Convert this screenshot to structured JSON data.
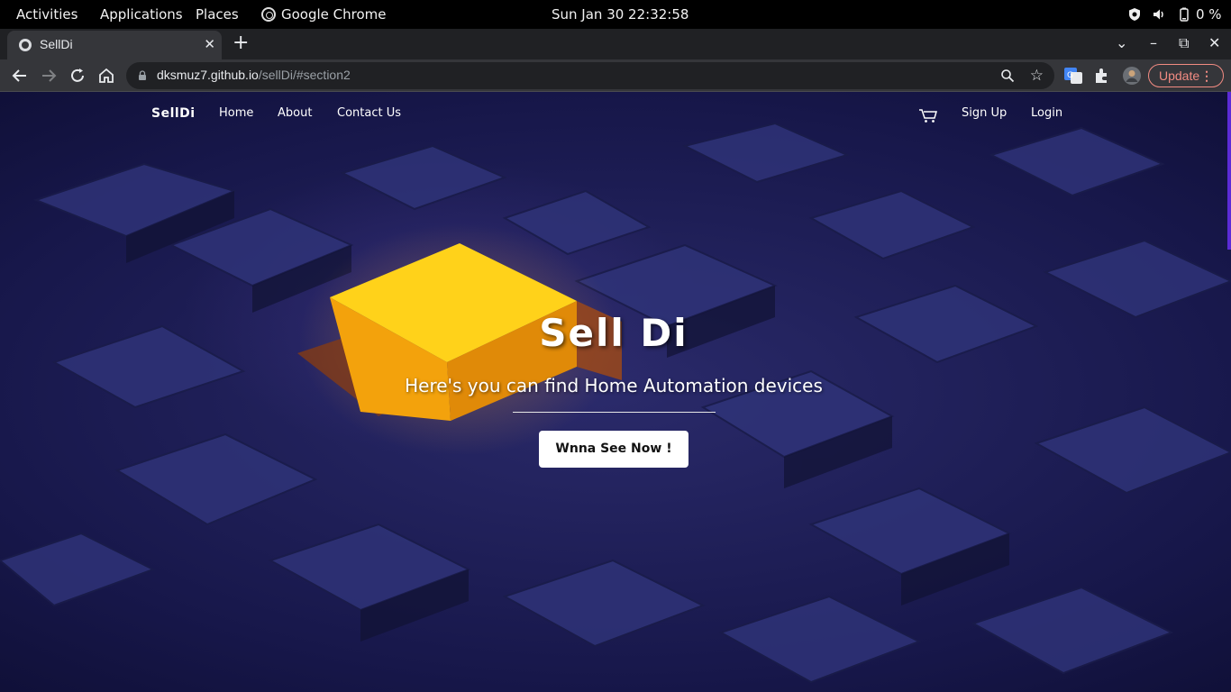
{
  "os_bar": {
    "activities": "Activities",
    "applications": "Applications",
    "places": "Places",
    "app_name": "Google Chrome",
    "clock": "Sun Jan 30  22:32:58",
    "battery": "0 %"
  },
  "browser": {
    "tab_title": "SellDi",
    "url_host": "dksmuz7.github.io",
    "url_path": "/sellDi/#section2",
    "update_label": "Update"
  },
  "site": {
    "brand": "SellDi",
    "nav": [
      "Home",
      "About",
      "Contact Us"
    ],
    "sign_up": "Sign Up",
    "login": "Login",
    "hero_title": "Sell Di",
    "hero_subtitle": "Here's you can find Home Automation devices",
    "cta": "Wnna See Now !"
  },
  "colors": {
    "accent_update": "#f28b82",
    "scroll_thumb": "#5b2bd6",
    "hero_bg": "#17174a"
  },
  "icons": [
    "chrome-icon",
    "shield-icon",
    "volume-icon",
    "battery-icon",
    "favicon-icon",
    "back-icon",
    "forward-icon",
    "reload-icon",
    "home-icon",
    "lock-icon",
    "zoom-icon",
    "star-icon",
    "translate-icon",
    "extensions-icon",
    "profile-avatar",
    "cart-icon"
  ]
}
